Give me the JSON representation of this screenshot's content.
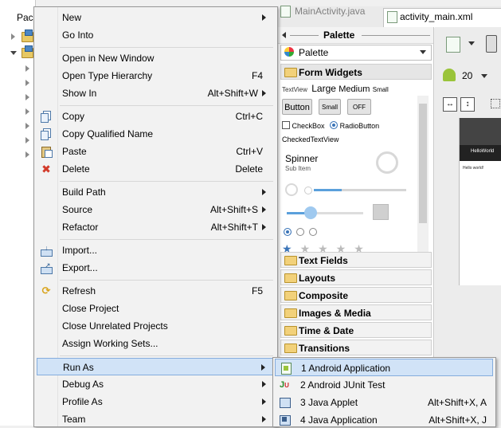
{
  "package_explorer": {
    "tab_label": "Pac"
  },
  "editor": {
    "tabs": [
      {
        "label": "MainActivity.java"
      },
      {
        "label": "activity_main.xml"
      }
    ],
    "api_level": "20"
  },
  "palette": {
    "header": "Palette",
    "selector": "Palette",
    "form_widgets": {
      "title": "Form Widgets",
      "textview_small": "TextView",
      "textview_large": "Large",
      "textview_medium": "Medium",
      "textview_smallest": "Small",
      "button": "Button",
      "small_button": "Small",
      "toggle": "OFF",
      "checkbox": "CheckBox",
      "radio": "RadioButton",
      "checked_textview": "CheckedTextView",
      "spinner": "Spinner",
      "spinner_sub": "Sub Item"
    },
    "categories": [
      "Text Fields",
      "Layouts",
      "Composite",
      "Images & Media",
      "Time & Date",
      "Transitions"
    ]
  },
  "device_preview": {
    "app_title": "HelloWorld",
    "content": "Hello world!"
  },
  "context_menu": {
    "items": [
      {
        "label": "New",
        "shortcut": "",
        "submenu": true,
        "icon": ""
      },
      {
        "label": "Go Into",
        "shortcut": "",
        "submenu": false,
        "icon": ""
      },
      {
        "label": "Open in New Window",
        "shortcut": "",
        "submenu": false,
        "icon": ""
      },
      {
        "label": "Open Type Hierarchy",
        "shortcut": "F4",
        "submenu": false,
        "icon": ""
      },
      {
        "label": "Show In",
        "shortcut": "Alt+Shift+W",
        "submenu": true,
        "icon": ""
      },
      {
        "label": "Copy",
        "shortcut": "Ctrl+C",
        "submenu": false,
        "icon": "copy-icon"
      },
      {
        "label": "Copy Qualified Name",
        "shortcut": "",
        "submenu": false,
        "icon": "copy-qualified-icon"
      },
      {
        "label": "Paste",
        "shortcut": "Ctrl+V",
        "submenu": false,
        "icon": "paste-icon"
      },
      {
        "label": "Delete",
        "shortcut": "Delete",
        "submenu": false,
        "icon": "delete-icon"
      },
      {
        "label": "Build Path",
        "shortcut": "",
        "submenu": true,
        "icon": ""
      },
      {
        "label": "Source",
        "shortcut": "Alt+Shift+S",
        "submenu": true,
        "icon": ""
      },
      {
        "label": "Refactor",
        "shortcut": "Alt+Shift+T",
        "submenu": true,
        "icon": ""
      },
      {
        "label": "Import...",
        "shortcut": "",
        "submenu": false,
        "icon": "import-icon"
      },
      {
        "label": "Export...",
        "shortcut": "",
        "submenu": false,
        "icon": "export-icon"
      },
      {
        "label": "Refresh",
        "shortcut": "F5",
        "submenu": false,
        "icon": "refresh-icon"
      },
      {
        "label": "Close Project",
        "shortcut": "",
        "submenu": false,
        "icon": ""
      },
      {
        "label": "Close Unrelated Projects",
        "shortcut": "",
        "submenu": false,
        "icon": ""
      },
      {
        "label": "Assign Working Sets...",
        "shortcut": "",
        "submenu": false,
        "icon": ""
      },
      {
        "label": "Run As",
        "shortcut": "",
        "submenu": true,
        "icon": ""
      },
      {
        "label": "Debug As",
        "shortcut": "",
        "submenu": true,
        "icon": ""
      },
      {
        "label": "Profile As",
        "shortcut": "",
        "submenu": true,
        "icon": ""
      },
      {
        "label": "Team",
        "shortcut": "",
        "submenu": true,
        "icon": ""
      }
    ]
  },
  "run_as_submenu": {
    "items": [
      {
        "label": "1 Android Application",
        "shortcut": ""
      },
      {
        "label": "2 Android JUnit Test",
        "shortcut": ""
      },
      {
        "label": "3 Java Applet",
        "shortcut": "Alt+Shift+X, A"
      },
      {
        "label": "4 Java Application",
        "shortcut": "Alt+Shift+X, J"
      }
    ]
  },
  "colors": {
    "highlight": "#d1e3f7",
    "highlight_border": "#84acdd",
    "menu_bg": "#f2f2f2"
  }
}
